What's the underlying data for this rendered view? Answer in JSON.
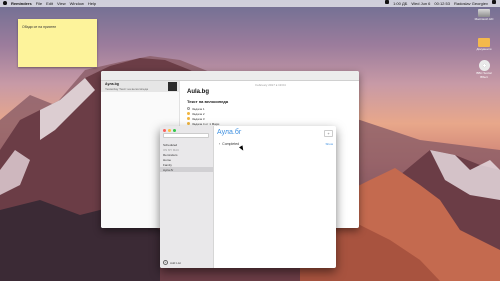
{
  "menubar": {
    "app_name": "Reminders",
    "menus": [
      "File",
      "Edit",
      "View",
      "Window",
      "Help"
    ],
    "status": [
      "1:00 ДБ",
      "Wed Jun 6",
      "00:12:53"
    ],
    "user": "Radoslav Georgiev"
  },
  "sticky": {
    "text": "Обади се на приятел"
  },
  "desktop_icons": [
    {
      "label": "Macintosh HD"
    },
    {
      "label": "Документи"
    },
    {
      "label": "BBC Social Bffect"
    }
  ],
  "notes_window": {
    "note_title": "Аула.bg",
    "note_subtitle": "Yesterday   Текст на велосипеда",
    "date_line": "February 2017 в 19:04",
    "heading": "Aula.bg",
    "subheading": "Текст на велосипеда",
    "checklist": [
      {
        "text": "Задача 1",
        "done": false
      },
      {
        "text": "Задача 2",
        "done": true
      },
      {
        "text": "Задача 3",
        "done": true
      },
      {
        "text": "Задача 4 от 1 Мари",
        "done": true
      }
    ]
  },
  "reminders_window": {
    "sidebar": {
      "items": [
        "Scheduled",
        "Reminders",
        "Home",
        "Family"
      ],
      "selected": "Аула.бг",
      "section_label": "ON MY MAC",
      "add_list_label": "Add List"
    },
    "title": "Аула.бг",
    "completed_label": "Completed",
    "show_label": "Show",
    "add_button_label": "+"
  }
}
